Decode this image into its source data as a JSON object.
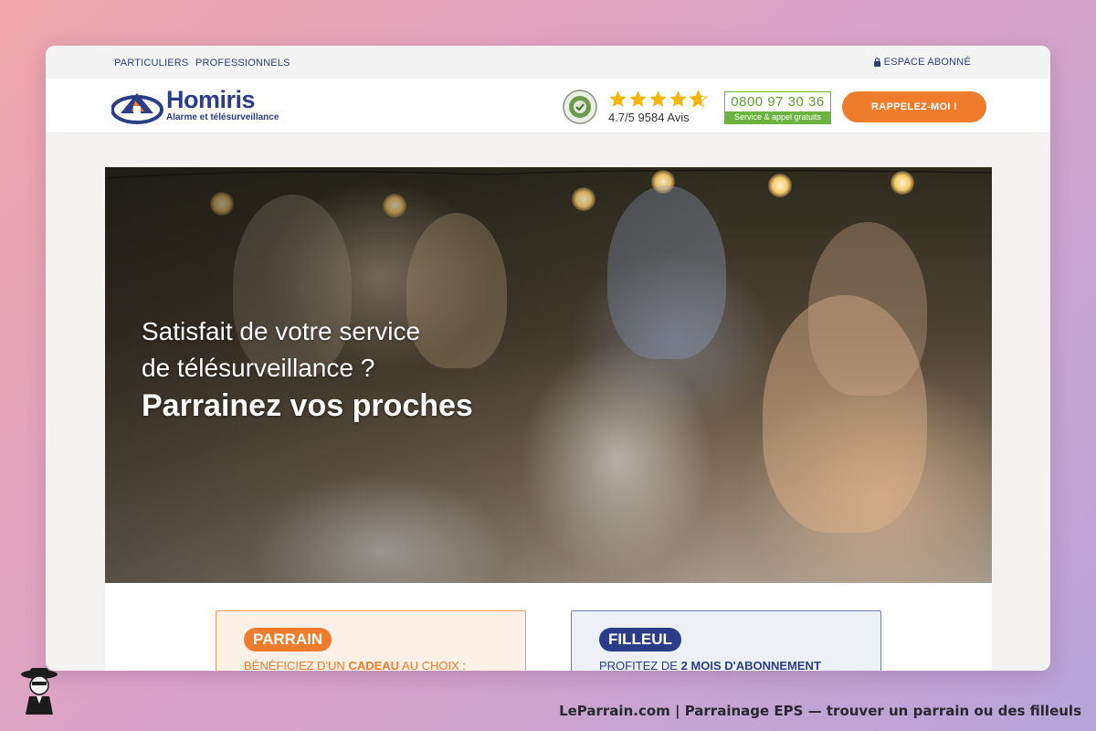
{
  "topbar": {
    "particuliers": "PARTICULIERS",
    "professionnels": "PROFESSIONNELS",
    "espace_abonne": "ESPACE ABONNÉ"
  },
  "header": {
    "brand_name": "Homiris",
    "brand_tagline": "Alarme et télésurveillance",
    "rating_text": "4.7/5 9584 Avis",
    "rating_value": 4.7,
    "phone_number": "0800 97 30 36",
    "phone_sub": "Service & appel gratuits",
    "cta_label": "RAPPELEZ-MOI !",
    "badge_icon": "elu-service-client-icon"
  },
  "hero": {
    "line1": "Satisfait de votre service",
    "line2": "de télésurveillance ?",
    "headline": "Parrainez vos proches"
  },
  "cards": {
    "parrain": {
      "tag": "PARRAIN",
      "text_prefix": "BÉNÉFICIEZ D'UN ",
      "text_bold": "CADEAU",
      "text_suffix": " AU CHOIX :"
    },
    "filleul": {
      "tag": "FILLEUL",
      "text_prefix": "PROFITEZ DE ",
      "text_bold": "2 MOIS D'ABONNEMENT",
      "text_suffix": ""
    }
  },
  "footer": {
    "caption": "LeParrain.com | Parrainage EPS — trouver un parrain ou des filleuls"
  },
  "colors": {
    "brand_blue": "#2b3d88",
    "accent_orange": "#ef7c2c",
    "phone_green": "#6db33f",
    "star_gold": "#f5b400"
  }
}
